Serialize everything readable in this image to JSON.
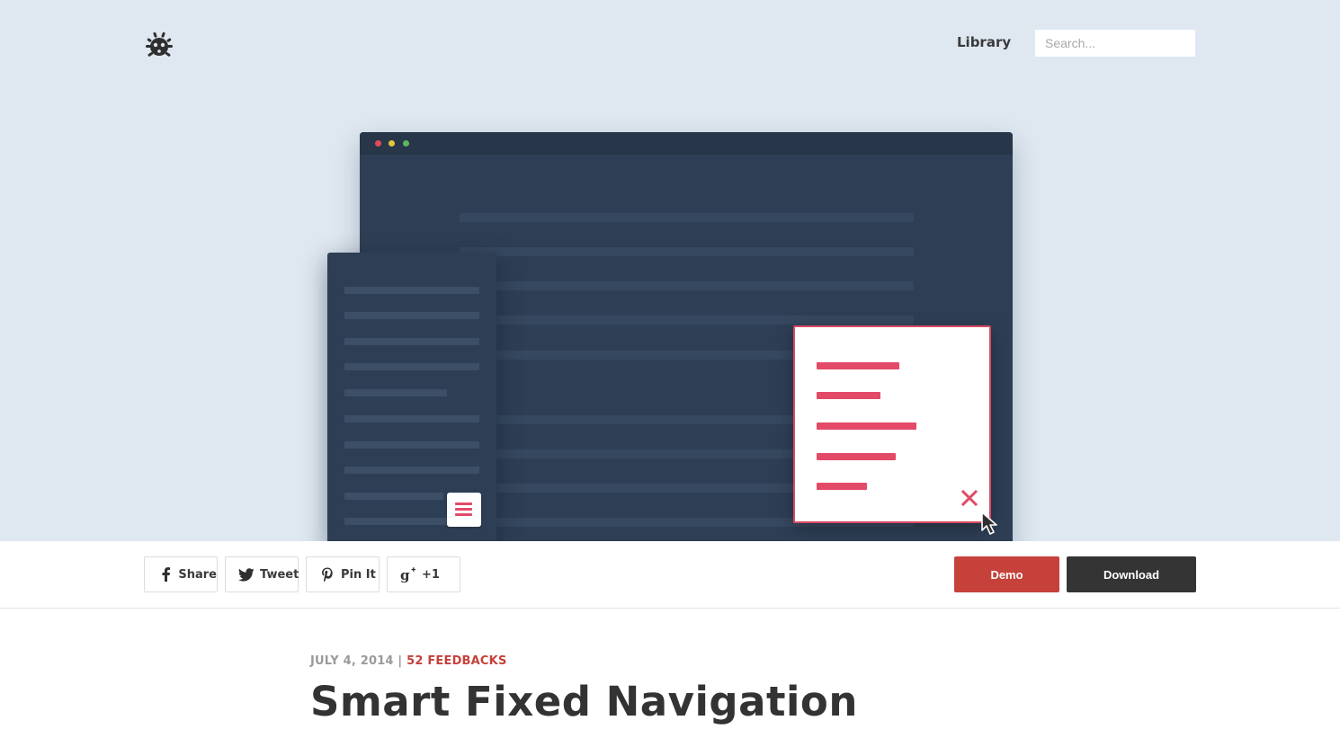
{
  "header": {
    "logo_icon": "bug-icon",
    "nav_library": "Library",
    "search_placeholder": "Search..."
  },
  "illustration": {
    "window_dots": [
      "#e04b5a",
      "#e8c23c",
      "#5cb85c"
    ],
    "accent": "#e24a68",
    "menu_icon": "hamburger-icon",
    "close_icon": "close-icon",
    "cursor_icon": "cursor-icon"
  },
  "share": {
    "facebook": "Share",
    "twitter": "Tweet",
    "pinterest": "Pin It",
    "googleplus": "+1"
  },
  "actions": {
    "demo": "Demo",
    "download": "Download",
    "demo_color": "#c5413a",
    "download_color": "#343434"
  },
  "article": {
    "date": "JULY 4, 2014",
    "separator": "|",
    "feedbacks": "52 FEEDBACKS",
    "title": "Smart Fixed Navigation"
  }
}
